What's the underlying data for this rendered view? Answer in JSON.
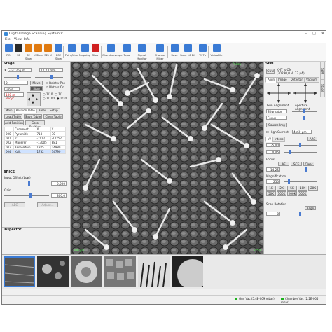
{
  "window": {
    "title": "Digital Image Scanning System V",
    "controls": [
      "–",
      "□",
      "✕"
    ]
  },
  "menu": [
    "File",
    "View",
    "Info"
  ],
  "toolbar": [
    {
      "label": "ROI",
      "color": "#3a7bd5",
      "icon": "roi-icon"
    },
    {
      "label": "SE",
      "color": "#2a2a2a",
      "icon": "se-icon"
    },
    {
      "label": "SE Slow",
      "color": "#e07a10",
      "icon": "se-slow-icon"
    },
    {
      "label": "X Slow",
      "color": "#e07a10",
      "icon": "x-slow-icon"
    },
    {
      "label": "SE+X",
      "color": "#e07a10",
      "icon": "se-x-icon"
    },
    {
      "label": "BSE Slow",
      "color": "#3a7bd5",
      "icon": "bse-slow-icon"
    },
    {
      "label": "Point/Line",
      "color": "#3a7bd5",
      "icon": "point-line-icon"
    },
    {
      "label": "Mapping",
      "color": "#3a7bd5",
      "icon": "mapping-icon"
    },
    {
      "label": "Stop",
      "color": "#d02020",
      "icon": "stop-icon"
    },
    {
      "label": "Chamberscope",
      "color": "#3a7bd5",
      "icon": "chamberscope-icon"
    },
    {
      "label": "Topo",
      "color": "#3a7bd5",
      "icon": "topo-icon"
    },
    {
      "label": "Signal Monitor",
      "color": "#3a7bd5",
      "icon": "signal-monitor-icon"
    },
    {
      "label": "Channel Mixer",
      "color": "#3a7bd5",
      "icon": "channel-mixer-icon"
    },
    {
      "label": "Save",
      "color": "#3a7bd5",
      "icon": "save-icon"
    },
    {
      "label": "Save 16 Bit",
      "color": "#3a7bd5",
      "icon": "save-16bit-icon"
    },
    {
      "label": "TIFFs",
      "color": "#3a7bd5",
      "icon": "tiffs-icon"
    },
    {
      "label": "VideoFile",
      "color": "#3a7bd5",
      "icon": "video-file-icon"
    }
  ],
  "stage": {
    "title": "Stage",
    "x_label": "X",
    "x_value": "-14125 µm",
    "y_value": "12,73 mm",
    "r_value": "0",
    "move_label": "Move",
    "stop_label": "Stop",
    "relative_pos": "Relativ Pos",
    "motors_on": "Motors On",
    "speed_unit": "µm/s",
    "step_label": "100 m Pncyc",
    "radio_options": [
      "1/10",
      "1/1",
      "1/100",
      "1/10"
    ]
  },
  "tabs_stage": [
    "Main",
    "Position Table",
    "Areas",
    "Setup"
  ],
  "position_table": {
    "buttons": [
      "Load Table",
      "Save Table",
      "Clear Table",
      "Add Position",
      "Goto Position"
    ],
    "headers": [
      "",
      "Comment",
      "X",
      "Y"
    ],
    "rows": [
      [
        "000",
        "Pyramide",
        "718",
        "70"
      ],
      [
        "001",
        "IC",
        "-2112",
        "-10252"
      ],
      [
        "002",
        "Magerer",
        "-13005",
        "881"
      ],
      [
        "003",
        "Kesselstein",
        "1825",
        "14980"
      ],
      [
        "004",
        "Kalk",
        "1732",
        "14790"
      ]
    ]
  },
  "brics": {
    "title": "BRICS",
    "input_offset": "Input Offset (Low)",
    "offset_value": "0,000",
    "gain_label": "Gain",
    "gain_value": "300,0",
    "abc_label": "ABC",
    "adjust_label": "Adjust..."
  },
  "inspector": {
    "title": "Inspector"
  },
  "image_overlay": {
    "scale": "200 µm",
    "label_top": "Pollen",
    "mag": "x250"
  },
  "sem": {
    "title": "SEM",
    "gun_label": "GUN",
    "kv": "KHT is ON",
    "kv2": "(20230,0 V, 77 µA)",
    "tabs": [
      "Align",
      "Image",
      "Detector",
      "Vacuum"
    ],
    "gun_alignment": "Gun Alignment",
    "aperture_alignment": "Aperture Alignment",
    "stigmator": "Stigmator",
    "focus": "Focus",
    "source_img": "Source Img",
    "high_current": "High Current",
    "hc_value": "4x60 µm",
    "lens_tabs": [
      "kV",
      "Intens"
    ],
    "arc_label": "ARC",
    "kv_value": "-5,00",
    "intens_value": "0,45",
    "focus_label": "Focus",
    "focus_buttons": [
      "AF",
      "SCE",
      "Clear"
    ],
    "focus_value": "14,25",
    "magnification": "Magnification",
    "mag_value": "250",
    "mag_buttons": [
      "1K",
      "2K",
      "5K",
      "10K",
      "20K",
      "50K",
      "100K",
      "200K",
      "500K"
    ],
    "scan_rotation": "Scan Rotation",
    "align_label": "Align",
    "rot_value": "0"
  },
  "side_tabs": [
    "SEM",
    "Stage"
  ],
  "status": {
    "gun_vac": "Gun Vac",
    "gun_val": "(5,4E-009 mbar)",
    "chamber_vac": "Chamber Vac",
    "chamber_val": "(2,2E-005 mbar)"
  },
  "colors": {
    "accent": "#3a7bd5",
    "led": "#1db31d",
    "stop": "#d02020"
  }
}
